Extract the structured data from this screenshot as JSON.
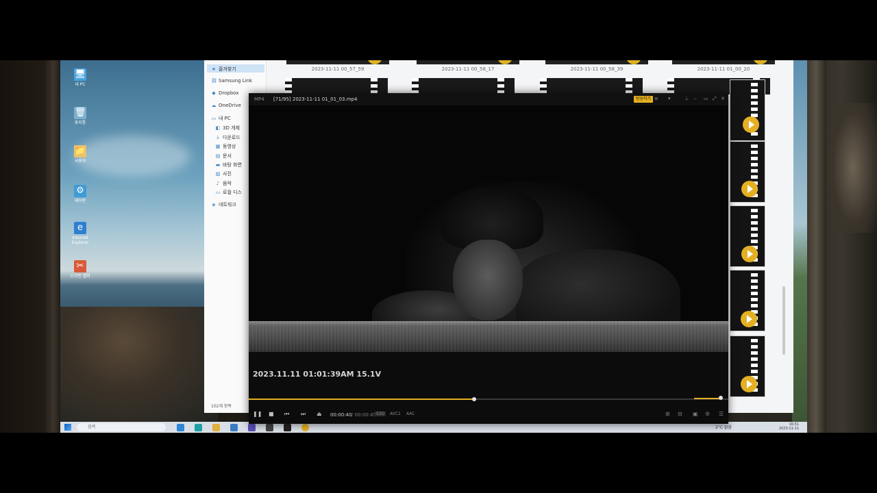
{
  "desktop": {
    "icons": [
      {
        "label": "내 PC",
        "glyph": "🖥",
        "color": "#4aa3df"
      },
      {
        "label": "휴지통",
        "glyph": "🗑",
        "color": "#7fb1cf"
      },
      {
        "label": "사용자",
        "glyph": "📁",
        "color": "#e9c26a"
      },
      {
        "label": "제어판",
        "glyph": "⚙",
        "color": "#3f9bd6"
      },
      {
        "label": "Internet Explorer",
        "glyph": "e",
        "color": "#2f7fd0"
      },
      {
        "label": "스크린 캡처",
        "glyph": "✂",
        "color": "#d95a3a"
      }
    ]
  },
  "explorer": {
    "nav": [
      {
        "label": "즐겨찾기",
        "icon": "star-icon",
        "glyph": "★"
      },
      {
        "label": "Samsung Link",
        "icon": "link-icon",
        "glyph": "⛓"
      },
      {
        "label": "Dropbox",
        "icon": "dropbox-icon",
        "glyph": "◆"
      },
      {
        "label": "OneDrive",
        "icon": "cloud-icon",
        "glyph": "☁"
      },
      {
        "label": "내 PC",
        "icon": "pc-icon",
        "glyph": "▭"
      },
      {
        "label": "3D 개체",
        "icon": "cube-icon",
        "glyph": "◧"
      },
      {
        "label": "다운로드",
        "icon": "download-icon",
        "glyph": "↓"
      },
      {
        "label": "동영상",
        "icon": "video-icon",
        "glyph": "▦"
      },
      {
        "label": "문서",
        "icon": "document-icon",
        "glyph": "▤"
      },
      {
        "label": "바탕 화면",
        "icon": "desktop-icon",
        "glyph": "▬"
      },
      {
        "label": "사진",
        "icon": "picture-icon",
        "glyph": "▨"
      },
      {
        "label": "음악",
        "icon": "music-icon",
        "glyph": "♪"
      },
      {
        "label": "로컬 디스",
        "icon": "disk-icon",
        "glyph": "▭"
      },
      {
        "label": "네트워크",
        "icon": "network-icon",
        "glyph": "◈"
      }
    ],
    "status": "102개 항목",
    "thumbnails_top": [
      "2023-11-11 00_57_59",
      "2023-11-11 00_58_17",
      "2023-11-11 00_58_39",
      "2023-11-11 01_00_20"
    ]
  },
  "taskbar": {
    "search_placeholder": "검색",
    "tray": "2°C 맑음",
    "clock_time": "16:51",
    "clock_date": "2023-11-11"
  },
  "player": {
    "format": "MP4",
    "title": "[71/95] 2023-11-11 01_01_03.mp4",
    "badge": "방송하기",
    "osd": "2023.11.11 01:01:39AM 15.1V",
    "time_current": "00:00:40",
    "time_total": "/ 00:00:45",
    "tags": [
      "S3D",
      "AVC1",
      "AAC"
    ],
    "progress": 0.47,
    "volume": 0.85
  },
  "colors": {
    "accent": "#e5b122"
  }
}
